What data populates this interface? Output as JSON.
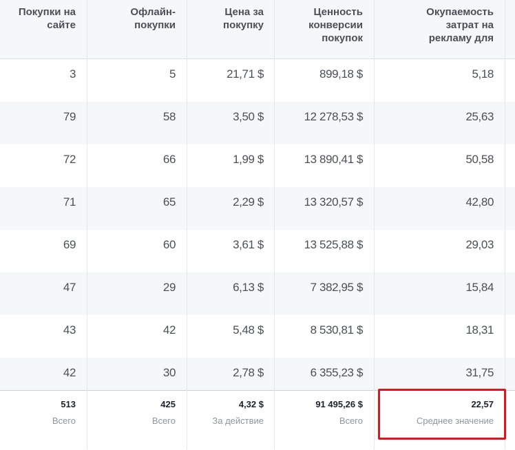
{
  "table": {
    "columns": [
      {
        "label": "Покупки на\nсайте"
      },
      {
        "label": "Офлайн-\nпокупки"
      },
      {
        "label": "Цена за\nпокупку"
      },
      {
        "label": "Ценность\nконверсии\nпокупок"
      },
      {
        "label": "Окупаемость\nзатрат на\nрекламу для"
      }
    ],
    "rows": [
      [
        "3",
        "5",
        "21,71 $",
        "899,18 $",
        "5,18"
      ],
      [
        "79",
        "58",
        "3,50 $",
        "12 278,53 $",
        "25,63"
      ],
      [
        "72",
        "66",
        "1,99 $",
        "13 890,41 $",
        "50,58"
      ],
      [
        "71",
        "65",
        "2,29 $",
        "13 320,57 $",
        "42,80"
      ],
      [
        "69",
        "60",
        "3,61 $",
        "13 525,88 $",
        "29,03"
      ],
      [
        "47",
        "29",
        "6,13 $",
        "7 382,95 $",
        "15,84"
      ],
      [
        "43",
        "42",
        "5,48 $",
        "8 530,81 $",
        "18,31"
      ],
      [
        "42",
        "30",
        "2,78 $",
        "6 355,23 $",
        "31,75"
      ]
    ],
    "totals": [
      {
        "value": "513",
        "label": "Всего"
      },
      {
        "value": "425",
        "label": "Всего"
      },
      {
        "value": "4,32 $",
        "label": "За действие"
      },
      {
        "value": "91 495,26 $",
        "label": "Всего"
      },
      {
        "value": "22,57",
        "label": "Среднее значение"
      }
    ]
  },
  "colors": {
    "header_bg": "#f6f7f9",
    "alt_row_bg": "#f6f7f9",
    "highlight_border": "#e0141d"
  }
}
